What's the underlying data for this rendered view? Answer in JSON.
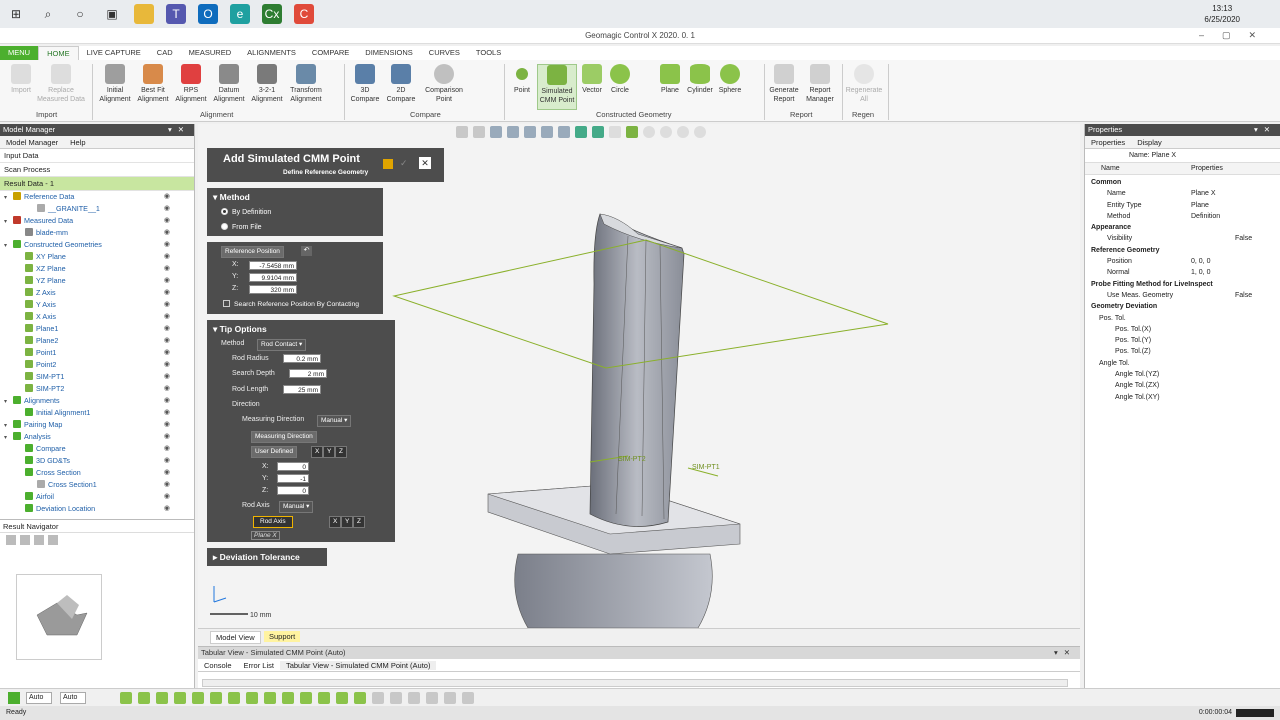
{
  "clock": {
    "time": "13:13",
    "date": "6/25/2020"
  },
  "app_title": "Geomagic Control X 2020. 0. 1",
  "ribbon_tabs": [
    "MENU",
    "HOME",
    "LIVE CAPTURE",
    "CAD",
    "MEASURED",
    "ALIGNMENTS",
    "COMPARE",
    "DIMENSIONS",
    "CURVES",
    "TOOLS"
  ],
  "ribbon": {
    "import": "Import",
    "replace": "Replace\nMeasured Data",
    "initial": "Initial\nAlignment",
    "bestfit": "Best Fit\nAlignment",
    "rps": "RPS\nAlignment",
    "datum": "Datum\nAlignment",
    "a321": "3-2-1\nAlignment",
    "transform": "Transform\nAlignment",
    "c3d": "3D\nCompare",
    "c2d": "2D\nCompare",
    "cpoint": "Comparison\nPoint",
    "point": "Point",
    "simcmm": "Simulated\nCMM Point",
    "vector": "Vector",
    "circle": "Circle",
    "plane": "Plane",
    "cylinder": "Cylinder",
    "sphere": "Sphere",
    "genreport": "Generate\nReport",
    "repmgr": "Report\nManager",
    "regen": "Regenerate\nAll",
    "groups": {
      "import": "Import",
      "alignment": "Alignment",
      "compare": "Compare",
      "constructed": "Constructed Geometry",
      "report": "Report",
      "regen": "Regen"
    }
  },
  "left": {
    "title": "Model Manager",
    "tab1": "Model Manager",
    "tab2": "Help",
    "input": "Input Data",
    "scan": "Scan Process",
    "result": "Result Data - 1",
    "tree": [
      {
        "l": "Reference Data",
        "d": 0,
        "c": "#c8a000"
      },
      {
        "l": "__GRANITE__1",
        "d": 2,
        "c": "#aaa"
      },
      {
        "l": "Measured Data",
        "d": 0,
        "c": "#c0392b"
      },
      {
        "l": "blade-mm",
        "d": 1,
        "c": "#888"
      },
      {
        "l": "Constructed Geometries",
        "d": 0,
        "c": "#4caf2e"
      },
      {
        "l": "XY Plane",
        "d": 1,
        "c": "#7cb342"
      },
      {
        "l": "XZ Plane",
        "d": 1,
        "c": "#7cb342"
      },
      {
        "l": "YZ Plane",
        "d": 1,
        "c": "#7cb342"
      },
      {
        "l": "Z Axis",
        "d": 1,
        "c": "#7cb342"
      },
      {
        "l": "Y Axis",
        "d": 1,
        "c": "#7cb342"
      },
      {
        "l": "X Axis",
        "d": 1,
        "c": "#7cb342"
      },
      {
        "l": "Plane1",
        "d": 1,
        "c": "#7cb342"
      },
      {
        "l": "Plane2",
        "d": 1,
        "c": "#7cb342"
      },
      {
        "l": "Point1",
        "d": 1,
        "c": "#7cb342"
      },
      {
        "l": "Point2",
        "d": 1,
        "c": "#7cb342"
      },
      {
        "l": "SIM-PT1",
        "d": 1,
        "c": "#7cb342"
      },
      {
        "l": "SIM-PT2",
        "d": 1,
        "c": "#7cb342"
      },
      {
        "l": "Alignments",
        "d": 0,
        "c": "#4caf2e"
      },
      {
        "l": "Initial Alignment1",
        "d": 1,
        "c": "#4caf2e"
      },
      {
        "l": "Pairing Map",
        "d": 0,
        "c": "#4caf2e"
      },
      {
        "l": "Analysis",
        "d": 0,
        "c": "#4caf2e"
      },
      {
        "l": "Compare",
        "d": 1,
        "c": "#4caf2e"
      },
      {
        "l": "3D GD&Ts",
        "d": 1,
        "c": "#4caf2e"
      },
      {
        "l": "Cross Section",
        "d": 1,
        "c": "#4caf2e"
      },
      {
        "l": "Cross Section1",
        "d": 2,
        "c": "#aaa"
      },
      {
        "l": "Airfoil",
        "d": 1,
        "c": "#4caf2e"
      },
      {
        "l": "Deviation Location",
        "d": 1,
        "c": "#4caf2e"
      }
    ],
    "navigator": "Result Navigator"
  },
  "dialog": {
    "title": "Add Simulated CMM Point",
    "subtitle": "Define Reference Geometry",
    "method": "Method",
    "bydef": "By Definition",
    "fromfile": "From File",
    "refpos": "Reference Position",
    "x": "-7.5458 mm",
    "y": "9.9104 mm",
    "z": "320 mm",
    "x_label": "X:",
    "y_label": "Y:",
    "z_label": "Z:",
    "search": "Search Reference Position By Contacting",
    "tip": "Tip Options",
    "method2": "Method",
    "rodcontact": "Rod Contact",
    "rodradius": "Rod Radius",
    "rr": "0.2 mm",
    "searchdepth": "Search Depth",
    "sd": "2 mm",
    "rodlength": "Rod Length",
    "rl": "25 mm",
    "direction": "Direction",
    "measdir": "Measuring Direction",
    "manual": "Manual",
    "measdirbtn": "Measuring Direction",
    "userdef": "User Defined",
    "X": "X",
    "Y": "Y",
    "Z": "Z",
    "ux": "0",
    "uy": "-1",
    "uz": "0",
    "rodaxis": "Rod Axis",
    "manual2": "Manual",
    "rodaxisbtn": "Rod Axis",
    "planex": "Plane X",
    "devtol": "Deviation Tolerance"
  },
  "viewport": {
    "scale": "10 mm",
    "label1": "SIM-PT1",
    "label2": "SIM-PT2"
  },
  "viewtabs": {
    "model": "Model View",
    "support": "Support"
  },
  "tabular": {
    "title": "Tabular View - Simulated CMM Point (Auto)",
    "console": "Console",
    "errors": "Error List",
    "tab": "Tabular View - Simulated CMM Point (Auto)"
  },
  "right": {
    "title": "Properties",
    "tab1": "Properties",
    "tab2": "Display",
    "name": "Name: Plane X",
    "col1": "Name",
    "col2": "Properties",
    "rows": [
      {
        "k": "Common",
        "v": "",
        "d": 0,
        "g": 1
      },
      {
        "k": "Name",
        "v": "Plane X",
        "d": 2
      },
      {
        "k": "Entity Type",
        "v": "Plane",
        "d": 2
      },
      {
        "k": "Method",
        "v": "Definition",
        "d": 2
      },
      {
        "k": "Appearance",
        "v": "",
        "d": 0,
        "g": 1
      },
      {
        "k": "Visibility",
        "v": "False",
        "d": 2,
        "c": 1
      },
      {
        "k": "Reference Geometry",
        "v": "",
        "d": 0,
        "g": 1
      },
      {
        "k": "Position",
        "v": "0, 0, 0",
        "d": 2
      },
      {
        "k": "Normal",
        "v": "1, 0, 0",
        "d": 2
      },
      {
        "k": "Probe Fitting Method for LiveInspect",
        "v": "",
        "d": 0,
        "g": 1
      },
      {
        "k": "Use Meas. Geometry",
        "v": "False",
        "d": 2,
        "c": 1
      },
      {
        "k": "Geometry Deviation",
        "v": "",
        "d": 0,
        "g": 1
      },
      {
        "k": "Pos. Tol.",
        "v": "",
        "d": 1
      },
      {
        "k": "Pos. Tol.(X)",
        "v": "",
        "d": 3
      },
      {
        "k": "Pos. Tol.(Y)",
        "v": "",
        "d": 3
      },
      {
        "k": "Pos. Tol.(Z)",
        "v": "",
        "d": 3
      },
      {
        "k": "Angle Tol.",
        "v": "",
        "d": 1
      },
      {
        "k": "Angle Tol.(YZ)",
        "v": "",
        "d": 3
      },
      {
        "k": "Angle Tol.(ZX)",
        "v": "",
        "d": 3
      },
      {
        "k": "Angle Tol.(XY)",
        "v": "",
        "d": 3
      }
    ]
  },
  "bottom": {
    "auto1": "Auto",
    "auto2": "Auto"
  },
  "status": {
    "ready": "Ready",
    "timer": "0:00:00:04"
  }
}
